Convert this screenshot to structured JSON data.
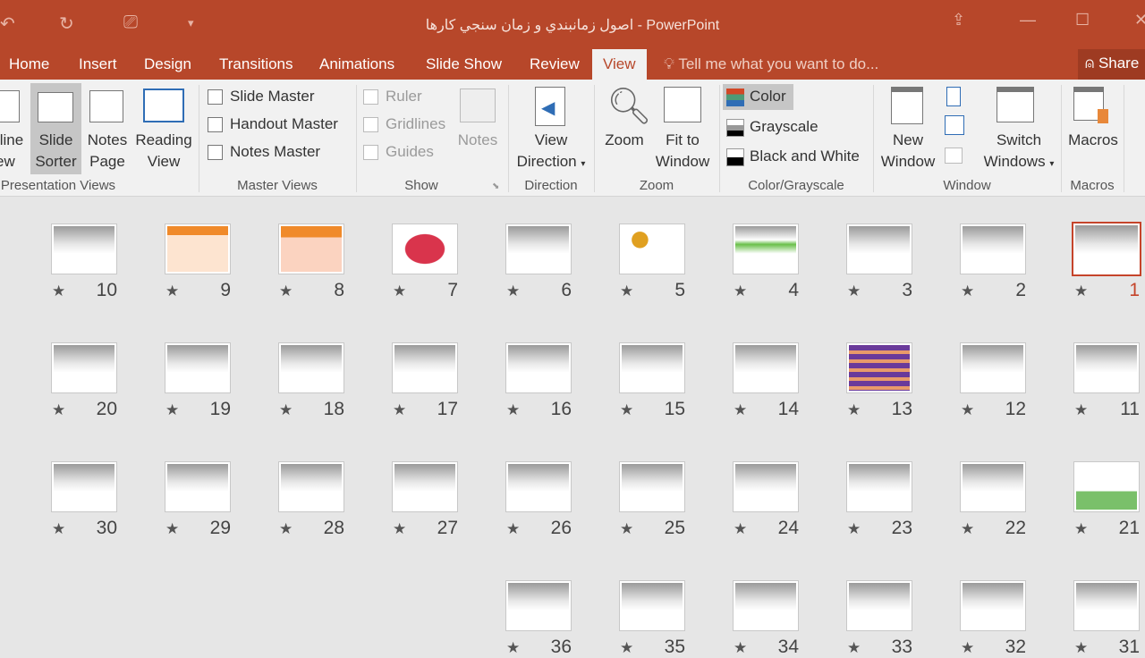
{
  "window": {
    "title": "اصول زمانبندي و زمان سنجي کارها - PowerPoint"
  },
  "tabs": [
    "Home",
    "Insert",
    "Design",
    "Transitions",
    "Animations",
    "Slide Show",
    "Review",
    "View"
  ],
  "active_tab": "View",
  "tell_me": "Tell me what you want to do...",
  "share": "Share",
  "ribbon": {
    "presentation_views": {
      "label": "Presentation Views",
      "outline": [
        "tline",
        "ew"
      ],
      "slide_sorter": [
        "Slide",
        "Sorter"
      ],
      "notes_page": [
        "Notes",
        "Page"
      ],
      "reading_view": [
        "Reading",
        "View"
      ]
    },
    "master_views": {
      "label": "Master Views",
      "items": [
        "Slide Master",
        "Handout Master",
        "Notes Master"
      ]
    },
    "show": {
      "label": "Show",
      "items": [
        "Ruler",
        "Gridlines",
        "Guides"
      ],
      "notes": "Notes"
    },
    "direction": {
      "label": "Direction",
      "button": [
        "View",
        "Direction"
      ]
    },
    "zoom": {
      "label": "Zoom",
      "zoom": "Zoom",
      "fit": [
        "Fit to",
        "Window"
      ]
    },
    "color": {
      "label": "Color/Grayscale",
      "items": [
        "Color",
        "Grayscale",
        "Black and White"
      ]
    },
    "window": {
      "label": "Window",
      "new": [
        "New",
        "Window"
      ],
      "switch": [
        "Switch",
        "Windows"
      ]
    },
    "macros": {
      "label": "Macros",
      "button": "Macros"
    }
  },
  "slides": [
    "1",
    "2",
    "3",
    "4",
    "5",
    "6",
    "7",
    "8",
    "9",
    "10",
    "11",
    "12",
    "13",
    "14",
    "15",
    "16",
    "17",
    "18",
    "19",
    "20",
    "21",
    "22",
    "23",
    "24",
    "25",
    "26",
    "27",
    "28",
    "29",
    "30",
    "31",
    "32",
    "33",
    "34",
    "35",
    "36"
  ],
  "selected_slide": "1",
  "accent": "#b7472a"
}
